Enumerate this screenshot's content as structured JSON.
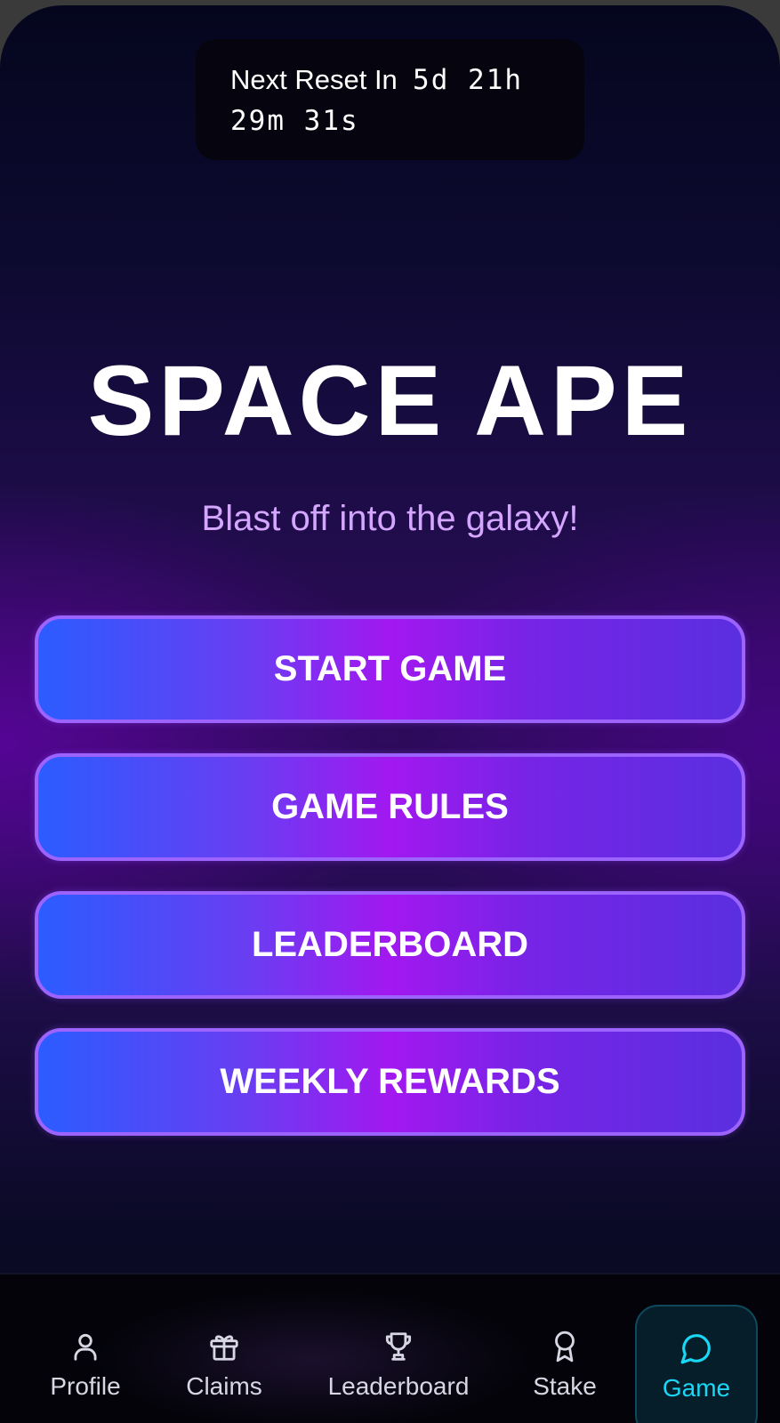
{
  "timer": {
    "label": "Next Reset In",
    "days_hours": "5d 21h",
    "minutes_seconds": "29m 31s"
  },
  "hero": {
    "title": "SPACE APE",
    "subtitle": "Blast off into the galaxy!"
  },
  "menu": {
    "start_game": "START GAME",
    "game_rules": "GAME RULES",
    "leaderboard": "LEADERBOARD",
    "weekly_rewards": "WEEKLY REWARDS"
  },
  "nav": {
    "items": [
      {
        "label": "Profile",
        "icon": "user-icon"
      },
      {
        "label": "Claims",
        "icon": "gift-icon"
      },
      {
        "label": "Leaderboard",
        "icon": "trophy-icon"
      },
      {
        "label": "Stake",
        "icon": "award-icon"
      },
      {
        "label": "Game",
        "icon": "chat-bubble-icon"
      }
    ],
    "active": "Game"
  },
  "colors": {
    "accent_cyan": "#19d7f5",
    "subtitle_purple": "#d4a6ff",
    "button_border": "#9d63ff"
  }
}
